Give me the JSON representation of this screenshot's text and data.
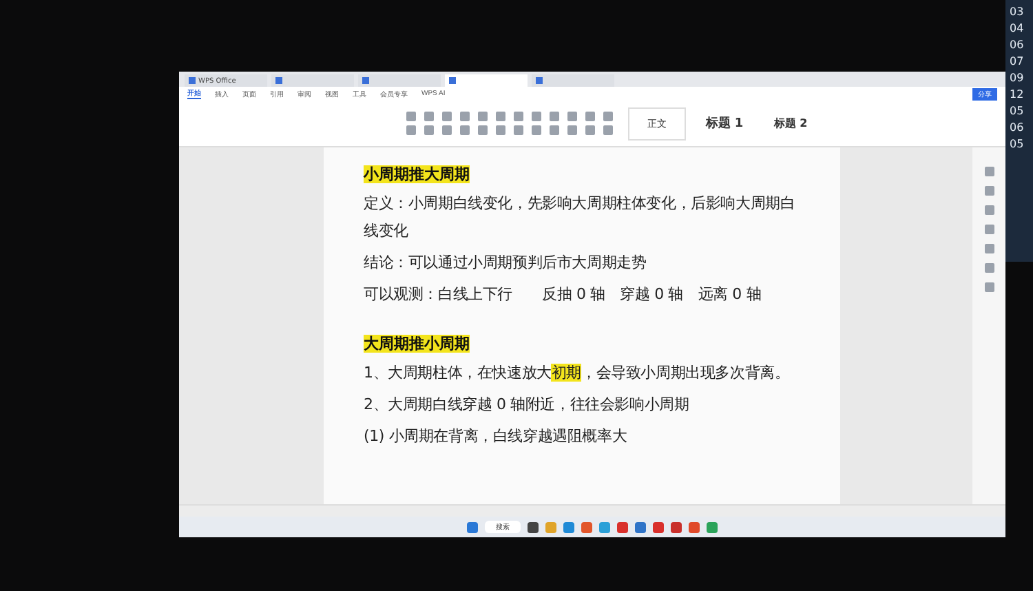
{
  "side_panel": {
    "numbers": [
      "03",
      "04",
      "06",
      "07",
      "09",
      "12",
      "05",
      "06",
      "05"
    ]
  },
  "window": {
    "tabs": [
      {
        "label": "WPS Office",
        "selected": false
      },
      {
        "selected": false
      },
      {
        "selected": false
      },
      {
        "selected": true
      },
      {
        "selected": false
      }
    ],
    "menu_tabs": [
      {
        "label": "开始",
        "selected": true
      },
      {
        "label": "插入",
        "selected": false
      },
      {
        "label": "页面",
        "selected": false
      },
      {
        "label": "引用",
        "selected": false
      },
      {
        "label": "审阅",
        "selected": false
      },
      {
        "label": "视图",
        "selected": false
      },
      {
        "label": "工具",
        "selected": false
      },
      {
        "label": "会员专享",
        "selected": false
      },
      {
        "label": "WPS AI",
        "selected": false
      }
    ],
    "share_button": "分享",
    "styles": [
      {
        "label": "正文",
        "kind": "body"
      },
      {
        "label": "标题 1",
        "kind": "h1"
      },
      {
        "label": "标题 2",
        "kind": "h2"
      }
    ],
    "document": [
      {
        "kind": "heading",
        "segments": [
          {
            "text": "小周期推大周期",
            "highlight": true
          }
        ]
      },
      {
        "kind": "para",
        "segments": [
          {
            "text": "定义：小周期白线变化，先影响大周期柱体变化，后影响大周期白线变化",
            "highlight": false
          }
        ]
      },
      {
        "kind": "para",
        "segments": [
          {
            "text": "结论：可以通过小周期预判后市大周期走势",
            "highlight": false
          }
        ]
      },
      {
        "kind": "para",
        "segments": [
          {
            "text": "可以观测：白线上下行　　反抽 0 轴　穿越 0 轴　远离 0 轴",
            "highlight": false
          }
        ]
      },
      {
        "kind": "gap"
      },
      {
        "kind": "heading",
        "segments": [
          {
            "text": "大周期推小周期",
            "highlight": true
          }
        ]
      },
      {
        "kind": "para",
        "segments": [
          {
            "text": "1、大周期柱体，在快速放大",
            "highlight": false
          },
          {
            "text": "初期",
            "highlight": true
          },
          {
            "text": "，会导致小周期出现多次背离。",
            "highlight": false
          }
        ]
      },
      {
        "kind": "para",
        "segments": [
          {
            "text": "2、大周期白线穿越 0 轴附近，往往会影响小周期",
            "highlight": false
          }
        ]
      },
      {
        "kind": "para",
        "segments": [
          {
            "text": "(1) 小周期在背离，白线穿越遇阻概率大",
            "highlight": false
          }
        ]
      }
    ]
  },
  "taskbar": {
    "search": "搜索"
  }
}
